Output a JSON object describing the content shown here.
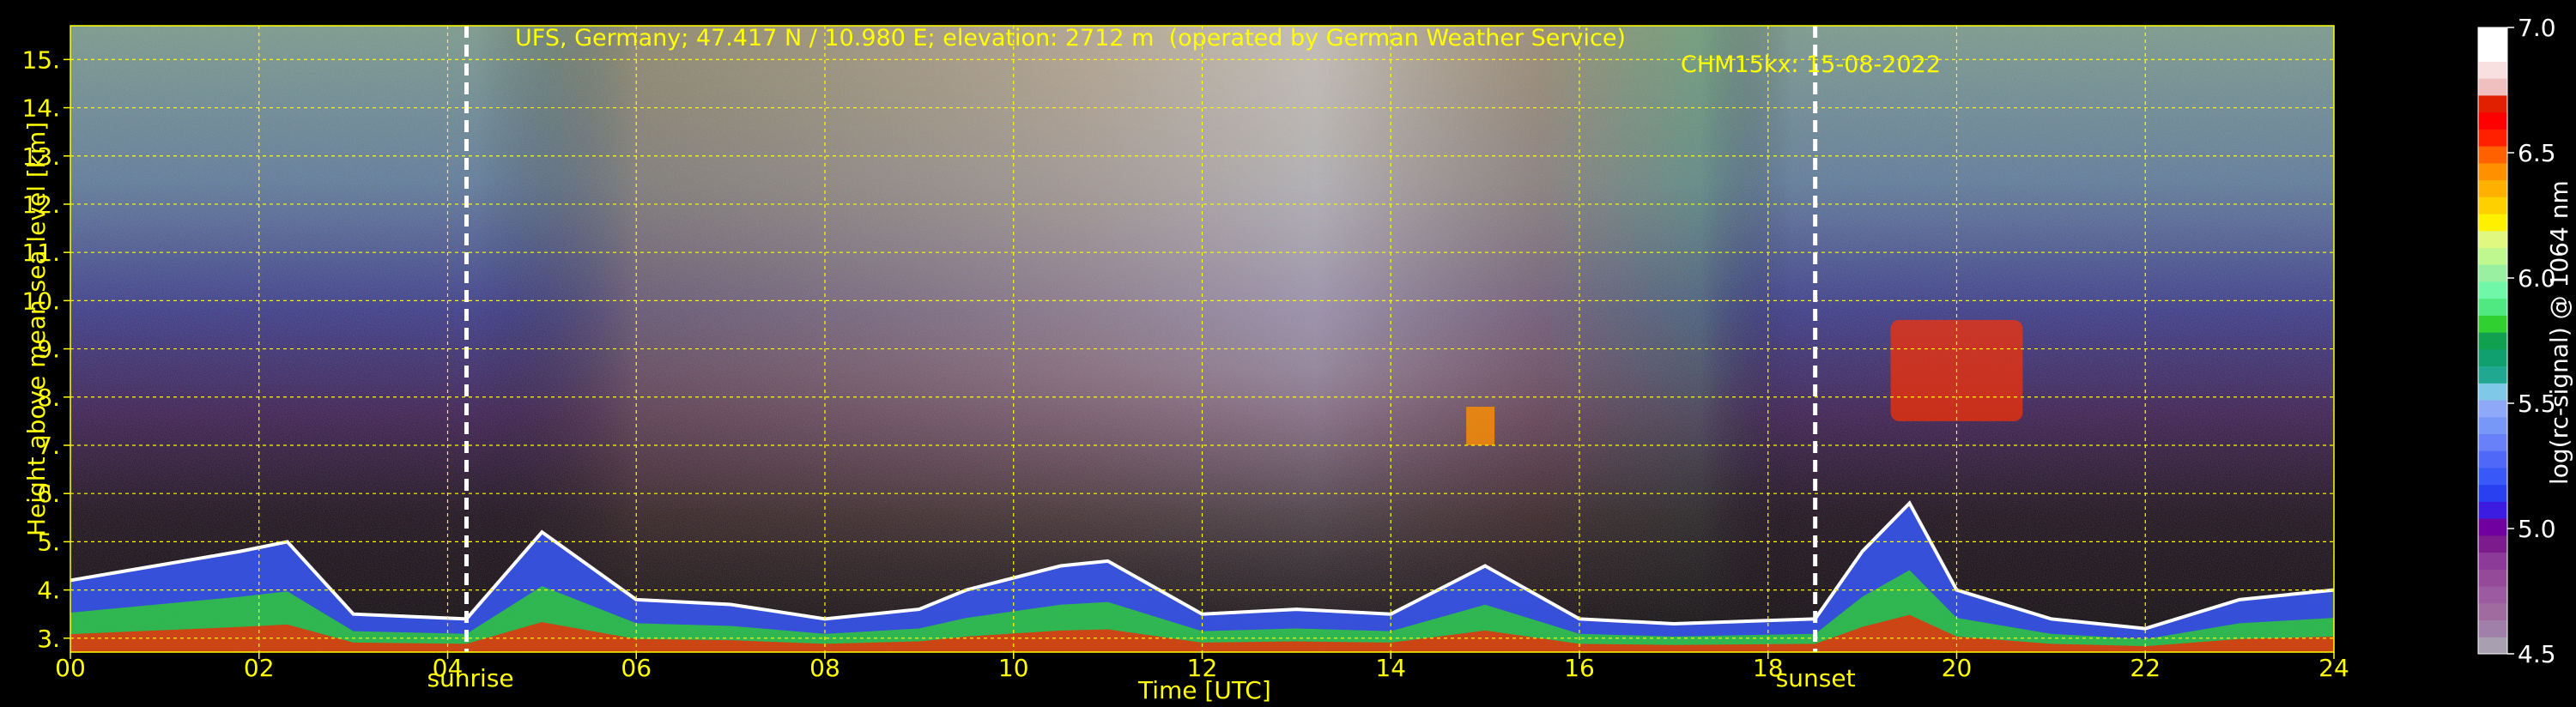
{
  "header": {
    "title_left": "UFS, Germany; 47.417 N / 10.980 E; elevation: 2712 m  (operated by German Weather Service)",
    "title_right": "CHM15kx: 15-08-2022"
  },
  "chart_data": {
    "type": "heatmap",
    "title": "UFS, Germany; 47.417 N / 10.980 E; elevation: 2712 m  (operated by German Weather Service)    CHM15kx: 15-08-2022",
    "xlabel": "Time [UTC]",
    "ylabel": "Height above mean sea level [km]",
    "xlim": [
      0,
      24
    ],
    "ylim": [
      2.712,
      15.7
    ],
    "x_ticks": [
      "00",
      "02",
      "04",
      "06",
      "08",
      "10",
      "12",
      "14",
      "16",
      "18",
      "20",
      "22",
      "24"
    ],
    "y_ticks": [
      "3.",
      "4.",
      "5.",
      "6.",
      "7.",
      "8.",
      "9.",
      "10.",
      "11.",
      "12.",
      "13.",
      "14.",
      "15."
    ],
    "grid": true,
    "colorbar": {
      "label": "log(rc-signal) @ 1064 nm",
      "range": [
        4.5,
        7.0
      ],
      "ticks": [
        "4.5",
        "5.0",
        "5.5",
        "6.0",
        "6.5",
        "7.0"
      ],
      "colors": [
        "#a8a0b0",
        "#a080a8",
        "#a06ca0",
        "#9c5aa0",
        "#944a98",
        "#8c3c98",
        "#7c1c8c",
        "#7000a0",
        "#3c1ce0",
        "#2840f0",
        "#3858f8",
        "#5068f8",
        "#6880f8",
        "#7898f8",
        "#90a8f8",
        "#80c8e8",
        "#20a890",
        "#10a070",
        "#10a050",
        "#30d030",
        "#50e880",
        "#70f8a8",
        "#98f0a0",
        "#c0f890",
        "#e0f880",
        "#fff000",
        "#ffd000",
        "#ffb000",
        "#ff9000",
        "#ff6000",
        "#ff2000",
        "#ff0000",
        "#e02000",
        "#f0c0c0",
        "#f8e0e0",
        "#ffffff",
        "#ffffff"
      ]
    },
    "vertical_markers": [
      {
        "label": "sunrise",
        "x": 4.2
      },
      {
        "label": "sunset",
        "x": 18.5
      }
    ],
    "features": {
      "surface_aerosol_layer_top_km": [
        [
          0,
          4.2
        ],
        [
          1.8,
          4.8
        ],
        [
          2.3,
          5.0
        ],
        [
          3.0,
          3.5
        ],
        [
          4.2,
          3.4
        ],
        [
          5.0,
          5.2
        ],
        [
          6.0,
          3.8
        ],
        [
          7.0,
          3.7
        ],
        [
          8.0,
          3.4
        ],
        [
          9.0,
          3.6
        ],
        [
          9.5,
          4.0
        ],
        [
          10.5,
          4.5
        ],
        [
          11.0,
          4.6
        ],
        [
          12.0,
          3.5
        ],
        [
          13.0,
          3.6
        ],
        [
          14.0,
          3.5
        ],
        [
          15.0,
          4.5
        ],
        [
          16.0,
          3.4
        ],
        [
          17.0,
          3.3
        ],
        [
          18.5,
          3.4
        ],
        [
          19.0,
          4.8
        ],
        [
          19.5,
          5.8
        ],
        [
          20.0,
          4.0
        ],
        [
          21.0,
          3.4
        ],
        [
          22.0,
          3.2
        ],
        [
          23.0,
          3.8
        ],
        [
          24.0,
          4.0
        ]
      ],
      "cirrus_cloud": {
        "x_range": [
          19.3,
          20.7
        ],
        "height_km": [
          7.5,
          9.6
        ]
      },
      "convective_signal": {
        "x_range": [
          14.8,
          15.1
        ],
        "height_km": [
          7.0,
          7.8
        ]
      }
    }
  }
}
